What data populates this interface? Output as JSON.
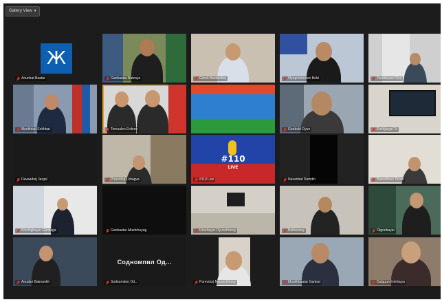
{
  "toolbar": {
    "view_button_label": "Gallery View",
    "chevron": "▾"
  },
  "icons": {
    "mic_muted": "mic-muted-icon"
  },
  "colors": {
    "frame_bg": "#1c1c1c",
    "tile_bg": "#141414",
    "muted_mic": "#e0322a",
    "label_text": "#e8e8e8"
  },
  "participants": [
    {
      "label": "Ariunbat Baatar"
    },
    {
      "label": "Ganbaatar Batzaya"
    },
    {
      "label": "Gerelt Baldandorj"
    },
    {
      "label": "Myagmarsuren Bold"
    },
    {
      "label": "Tsendsuren Dorj"
    },
    {
      "label": "Munkhbat Enkhbat"
    },
    {
      "label": "Temuulen Erdene"
    },
    {
      "label": ""
    },
    {
      "label": "Ganbold Oyun"
    },
    {
      "label": "Enkhjargal Ts"
    },
    {
      "label": "Davaadorj Jargal"
    },
    {
      "label": "Purevdorj Lkhagva"
    },
    {
      "label": "#110 Live"
    },
    {
      "label": "Nasanbat Damdin"
    },
    {
      "label": "Batsaikhan Tsend"
    },
    {
      "label": "Khishigbayar Gantulga"
    },
    {
      "label": "Ganbaatar Altankhuyag"
    },
    {
      "label": "Unurbayar Oyunchimeg"
    },
    {
      "label": "Battsetseg"
    },
    {
      "label": "Otgonbayar"
    },
    {
      "label": "Anudari Batmunkh"
    },
    {
      "label": "Sodnomdorj Od..."
    },
    {
      "label": "Purevdorj Naranchimeg"
    },
    {
      "label": "Munkhbaatar Ganbat"
    },
    {
      "label": "Dulguun Enkhtuya"
    }
  ],
  "tile_texts": {
    "zhe_logo": "Ж",
    "live_hash": "#110",
    "live_sub": "LIVE",
    "name_only": "Содномпил Од..."
  }
}
